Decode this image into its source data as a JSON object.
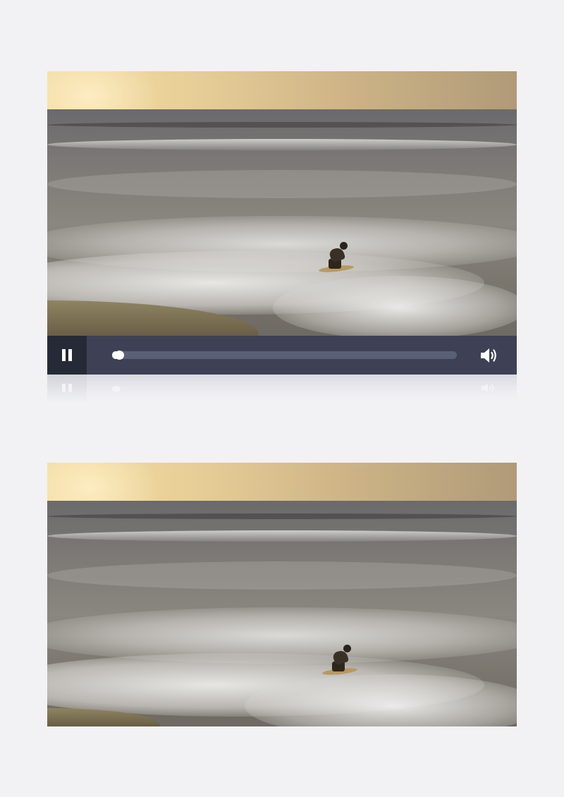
{
  "video_player": {
    "play_state": "playing",
    "controls": {
      "pause_icon": "pause-icon",
      "volume_icon": "volume-icon",
      "progress_fraction": 0.02
    }
  },
  "preview_frame": {
    "scene": "surfer-at-sunset"
  },
  "colors": {
    "page_background": "#f2f2f4",
    "control_bar": "#3e4155",
    "pause_button_bg": "#262936",
    "progress_track": "#5b5f76",
    "progress_knob": "#ffffff"
  }
}
